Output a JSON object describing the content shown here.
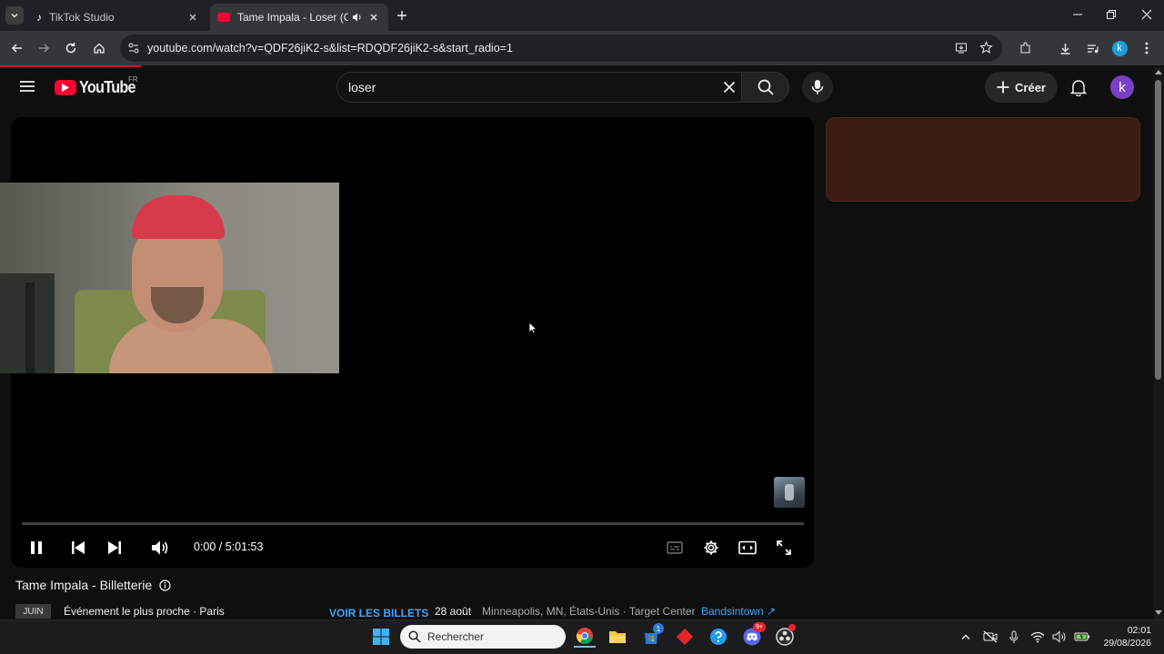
{
  "browser": {
    "tabs": [
      {
        "title": "TikTok Studio",
        "active": false
      },
      {
        "title": "Tame Impala - Loser (Officia",
        "active": true
      }
    ],
    "url": "youtube.com/watch?v=QDF26jiK2-s&list=RDQDF26jiK2-s&start_radio=1",
    "profile_initial": "k"
  },
  "youtube": {
    "logo_text": "YouTube",
    "region": "FR",
    "search_value": "loser",
    "create_label": "Créer",
    "avatar_initial": "k"
  },
  "player": {
    "time": "0:00 / 5:01:53",
    "progress": 0.0,
    "state": "playing"
  },
  "ticketing": {
    "title": "Tame Impala - Billetterie",
    "month": "JUIN",
    "nearest_event": "Événement le plus proche · Paris",
    "see_tickets": "VOIR LES BILLETS",
    "date": "28 août",
    "venue": "Minneapolis, MN, États-Unis · Target Center",
    "separator": "·",
    "provider": "Bandsintown ↗"
  },
  "taskbar": {
    "search_placeholder": "Rechercher",
    "time": "02:01",
    "date": "29/08/2026",
    "store_badge": "1",
    "discord_badge": "9+"
  },
  "colors": {
    "youtube_red": "#ff0033",
    "avatar": "#7b3fc4",
    "link": "#3ea6ff",
    "sidecard": "#3a1d10"
  }
}
